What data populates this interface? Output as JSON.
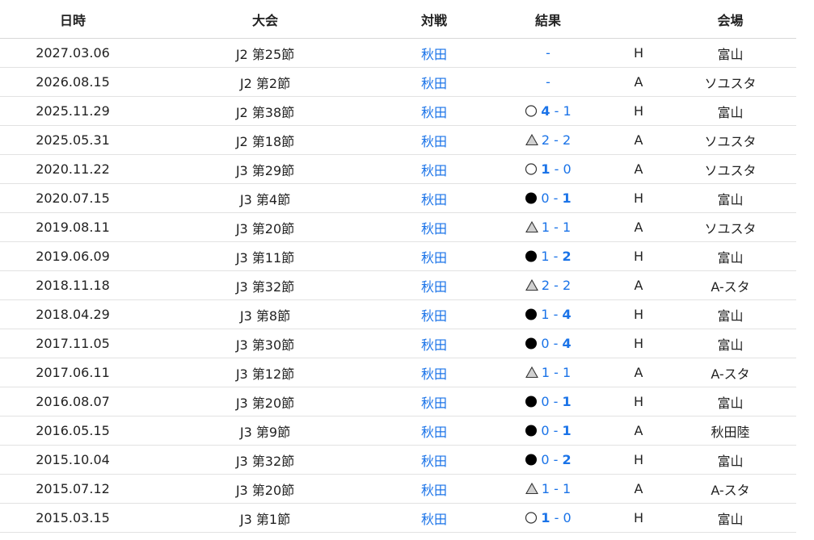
{
  "headers": {
    "date": "日時",
    "competition": "大会",
    "opponent": "対戦",
    "result": "結果",
    "homeaway": "",
    "venue": "会場"
  },
  "matches": [
    {
      "date": "2027.03.06",
      "competition": "J2 第25節",
      "opponent": "秋田",
      "result": "none",
      "score": "-",
      "home": "",
      "away": "",
      "bold": "",
      "ha": "H",
      "venue": "富山"
    },
    {
      "date": "2026.08.15",
      "competition": "J2 第2節",
      "opponent": "秋田",
      "result": "none",
      "score": "-",
      "home": "",
      "away": "",
      "bold": "",
      "ha": "A",
      "venue": "ソユスタ"
    },
    {
      "date": "2025.11.29",
      "competition": "J2 第38節",
      "opponent": "秋田",
      "result": "win",
      "score": "",
      "home": "4",
      "away": "1",
      "bold": "home",
      "ha": "H",
      "venue": "富山"
    },
    {
      "date": "2025.05.31",
      "competition": "J2 第18節",
      "opponent": "秋田",
      "result": "draw",
      "score": "",
      "home": "2",
      "away": "2",
      "bold": "",
      "ha": "A",
      "venue": "ソユスタ"
    },
    {
      "date": "2020.11.22",
      "competition": "J3 第29節",
      "opponent": "秋田",
      "result": "win",
      "score": "",
      "home": "1",
      "away": "0",
      "bold": "home",
      "ha": "A",
      "venue": "ソユスタ"
    },
    {
      "date": "2020.07.15",
      "competition": "J3 第4節",
      "opponent": "秋田",
      "result": "loss",
      "score": "",
      "home": "0",
      "away": "1",
      "bold": "away",
      "ha": "H",
      "venue": "富山"
    },
    {
      "date": "2019.08.11",
      "competition": "J3 第20節",
      "opponent": "秋田",
      "result": "draw",
      "score": "",
      "home": "1",
      "away": "1",
      "bold": "",
      "ha": "A",
      "venue": "ソユスタ"
    },
    {
      "date": "2019.06.09",
      "competition": "J3 第11節",
      "opponent": "秋田",
      "result": "loss",
      "score": "",
      "home": "1",
      "away": "2",
      "bold": "away",
      "ha": "H",
      "venue": "富山"
    },
    {
      "date": "2018.11.18",
      "competition": "J3 第32節",
      "opponent": "秋田",
      "result": "draw",
      "score": "",
      "home": "2",
      "away": "2",
      "bold": "",
      "ha": "A",
      "venue": "A-スタ"
    },
    {
      "date": "2018.04.29",
      "competition": "J3 第8節",
      "opponent": "秋田",
      "result": "loss",
      "score": "",
      "home": "1",
      "away": "4",
      "bold": "away",
      "ha": "H",
      "venue": "富山"
    },
    {
      "date": "2017.11.05",
      "competition": "J3 第30節",
      "opponent": "秋田",
      "result": "loss",
      "score": "",
      "home": "0",
      "away": "4",
      "bold": "away",
      "ha": "H",
      "venue": "富山"
    },
    {
      "date": "2017.06.11",
      "competition": "J3 第12節",
      "opponent": "秋田",
      "result": "draw",
      "score": "",
      "home": "1",
      "away": "1",
      "bold": "",
      "ha": "A",
      "venue": "A-スタ"
    },
    {
      "date": "2016.08.07",
      "competition": "J3 第20節",
      "opponent": "秋田",
      "result": "loss",
      "score": "",
      "home": "0",
      "away": "1",
      "bold": "away",
      "ha": "H",
      "venue": "富山"
    },
    {
      "date": "2016.05.15",
      "competition": "J3 第9節",
      "opponent": "秋田",
      "result": "loss",
      "score": "",
      "home": "0",
      "away": "1",
      "bold": "away",
      "ha": "A",
      "venue": "秋田陸"
    },
    {
      "date": "2015.10.04",
      "competition": "J3 第32節",
      "opponent": "秋田",
      "result": "loss",
      "score": "",
      "home": "0",
      "away": "2",
      "bold": "away",
      "ha": "H",
      "venue": "富山"
    },
    {
      "date": "2015.07.12",
      "competition": "J3 第20節",
      "opponent": "秋田",
      "result": "draw",
      "score": "",
      "home": "1",
      "away": "1",
      "bold": "",
      "ha": "A",
      "venue": "A-スタ"
    },
    {
      "date": "2015.03.15",
      "competition": "J3 第1節",
      "opponent": "秋田",
      "result": "win",
      "score": "",
      "home": "1",
      "away": "0",
      "bold": "home",
      "ha": "H",
      "venue": "富山"
    }
  ],
  "colors": {
    "link": "#1a73e8",
    "text": "#222222",
    "border": "#e2e2e2",
    "draw_fill": "#d0d0d0"
  },
  "icons": {
    "win": "white-circle-icon",
    "draw": "triangle-icon",
    "loss": "black-circle-icon"
  }
}
